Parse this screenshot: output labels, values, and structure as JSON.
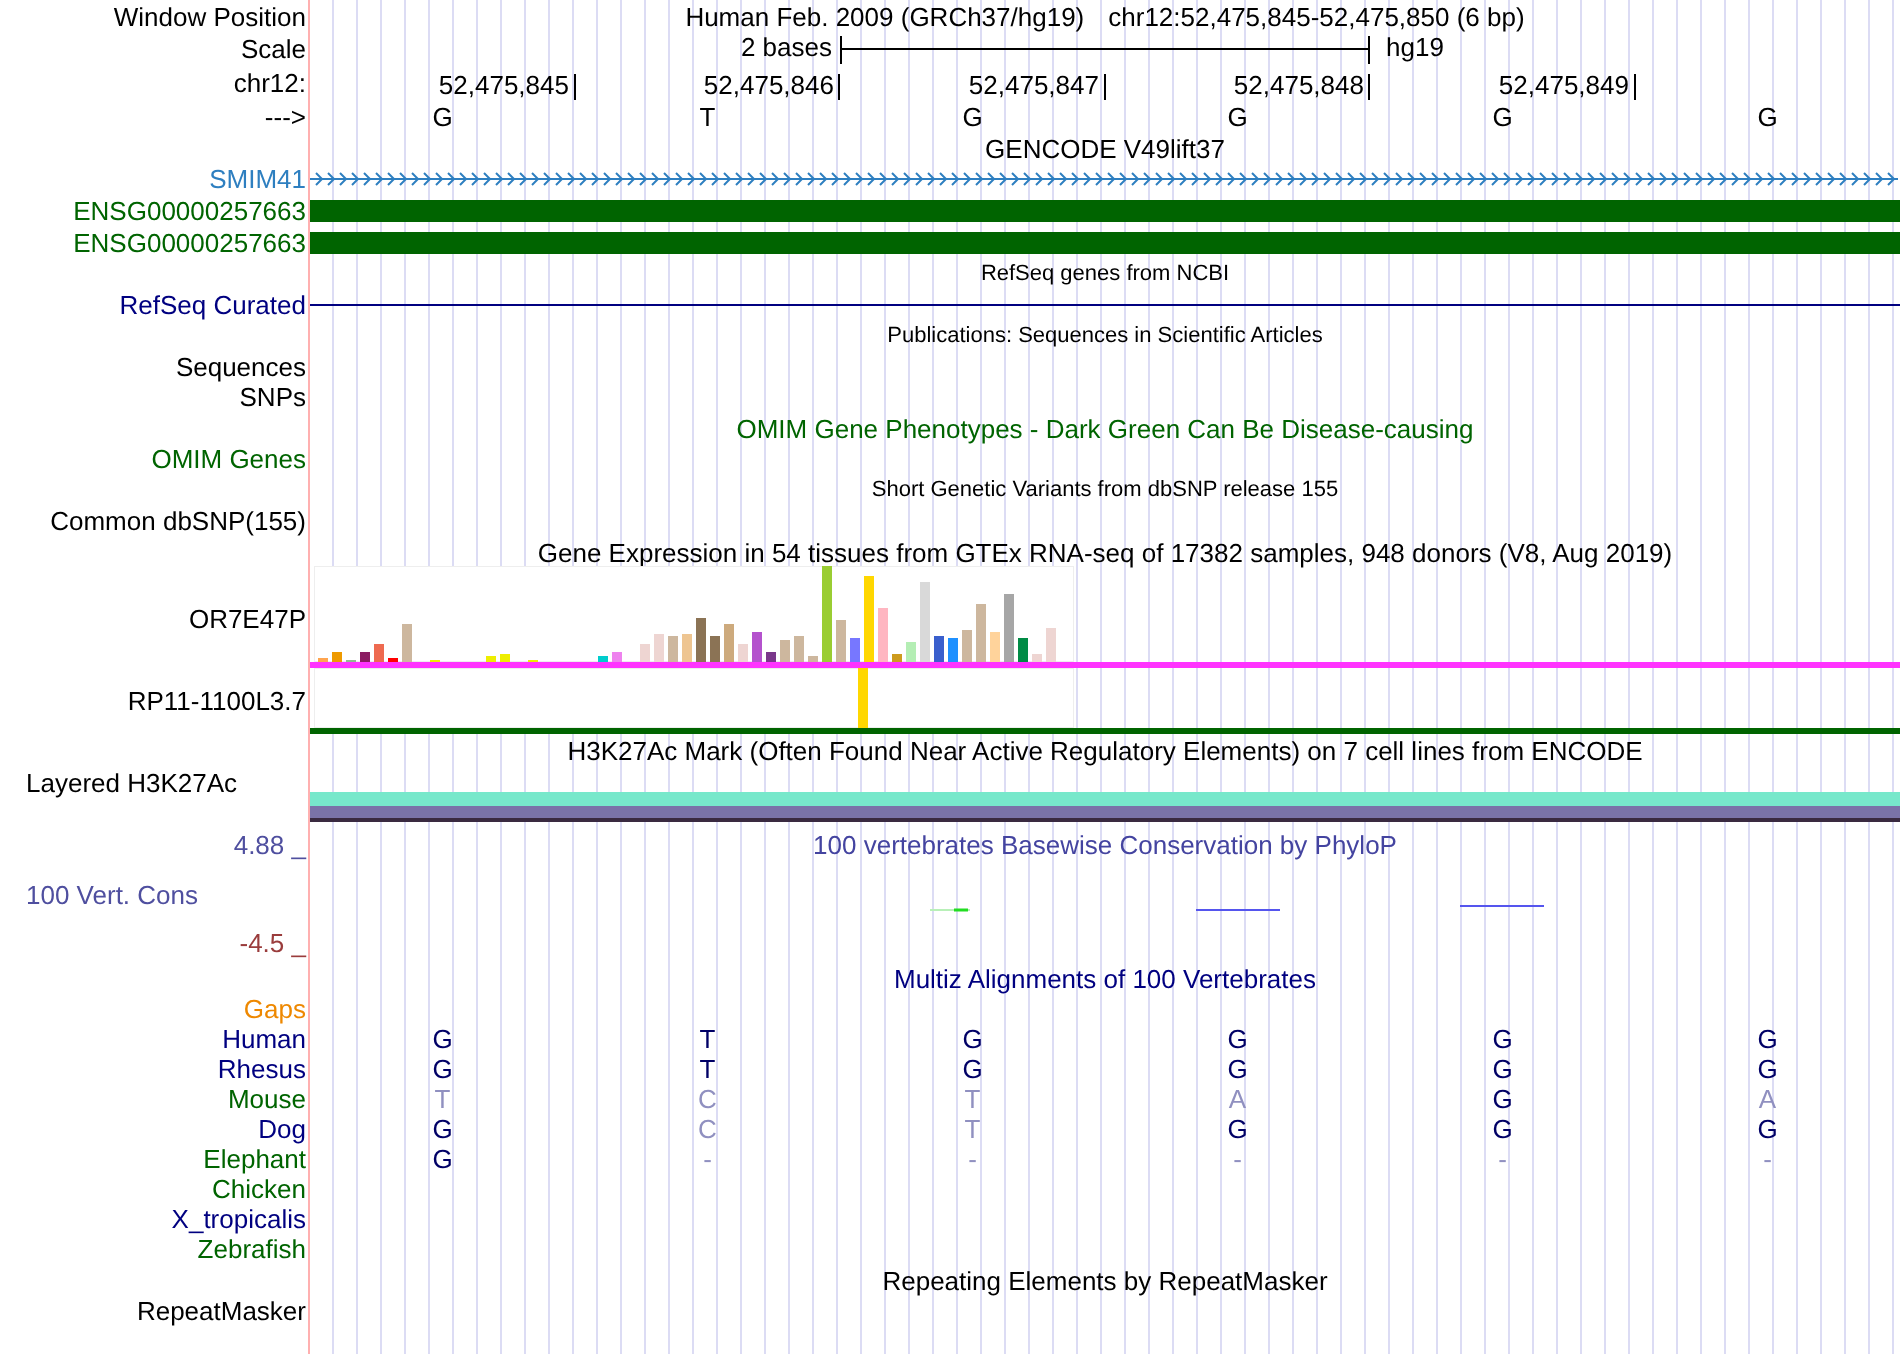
{
  "header": {
    "label": "Window Position",
    "assembly": "Human Feb. 2009 (GRCh37/hg19)",
    "position": "chr12:52,475,845-52,475,850 (6 bp)"
  },
  "scale": {
    "label": "Scale",
    "span": "2 bases",
    "assembly": "hg19"
  },
  "ruler": {
    "label": "chr12:",
    "positions": [
      "52,475,845",
      "52,475,846",
      "52,475,847",
      "52,475,848",
      "52,475,849"
    ]
  },
  "sequence": {
    "label": "--->",
    "bases": [
      "G",
      "T",
      "G",
      "G",
      "G",
      "G"
    ]
  },
  "tracks": [
    {
      "kind": "title",
      "text": "GENCODE V49lift37"
    },
    {
      "kind": "strand",
      "label": "SMIM41",
      "color": "#2e7fc0"
    },
    {
      "kind": "block",
      "label": "ENSG00000257663",
      "color": "#006400"
    },
    {
      "kind": "block",
      "label": "ENSG00000257663",
      "color": "#006400"
    },
    {
      "kind": "caption",
      "text": "RefSeq genes from NCBI"
    },
    {
      "kind": "line",
      "label": "RefSeq Curated",
      "color": "#000080"
    },
    {
      "kind": "caption",
      "text": "Publications: Sequences in Scientific Articles"
    },
    {
      "kind": "label",
      "label": "Sequences"
    },
    {
      "kind": "label",
      "label": "SNPs"
    },
    {
      "kind": "title",
      "text": "OMIM Gene Phenotypes - Dark Green Can Be Disease-causing",
      "color": "#006400"
    },
    {
      "kind": "label",
      "label": "OMIM Genes",
      "color": "#006400"
    },
    {
      "kind": "caption",
      "text": "Short Genetic Variants from dbSNP release 155"
    },
    {
      "kind": "label",
      "label": "Common dbSNP(155)"
    },
    {
      "kind": "title",
      "text": "Gene Expression in 54 tissues from GTEx RNA-seq of 17382 samples, 948 donors (V8, Aug 2019)"
    },
    {
      "kind": "expression",
      "label": "OR7E47P"
    },
    {
      "kind": "peak",
      "label": "RP11-1100L3.7"
    },
    {
      "kind": "title",
      "text": "H3K27Ac Mark (Often Found Near Active Regulatory Elements) on 7 cell lines from ENCODE"
    },
    {
      "kind": "layered",
      "label": "Layered H3K27Ac"
    },
    {
      "kind": "wiggle",
      "max": "4.88 _",
      "label": "100 Vert. Cons",
      "min": "-4.5 _",
      "title": "100 vertebrates Basewise Conservation by PhyloP"
    },
    {
      "kind": "title",
      "text": "Multiz Alignments of 100 Vertebrates",
      "color": "#000080"
    },
    {
      "kind": "label",
      "label": "Gaps",
      "color": "#ee8800"
    },
    {
      "kind": "alignment",
      "label": "Human",
      "color": "#000080",
      "bases": [
        {
          "base": "G",
          "match": true
        },
        {
          "base": "T",
          "match": true
        },
        {
          "base": "G",
          "match": true
        },
        {
          "base": "G",
          "match": true
        },
        {
          "base": "G",
          "match": true
        },
        {
          "base": "G",
          "match": true
        }
      ]
    },
    {
      "kind": "alignment",
      "label": "Rhesus",
      "color": "#000080",
      "bases": [
        {
          "base": "G",
          "match": true
        },
        {
          "base": "T",
          "match": true
        },
        {
          "base": "G",
          "match": true
        },
        {
          "base": "G",
          "match": true
        },
        {
          "base": "G",
          "match": true
        },
        {
          "base": "G",
          "match": true
        }
      ]
    },
    {
      "kind": "alignment",
      "label": "Mouse",
      "color": "#006400",
      "bases": [
        {
          "base": "T",
          "match": false
        },
        {
          "base": "C",
          "match": false
        },
        {
          "base": "T",
          "match": false
        },
        {
          "base": "A",
          "match": false
        },
        {
          "base": "G",
          "match": true
        },
        {
          "base": "A",
          "match": false
        }
      ]
    },
    {
      "kind": "alignment",
      "label": "Dog",
      "color": "#000080",
      "bases": [
        {
          "base": "G",
          "match": true
        },
        {
          "base": "C",
          "match": false
        },
        {
          "base": "T",
          "match": false
        },
        {
          "base": "G",
          "match": true
        },
        {
          "base": "G",
          "match": true
        },
        {
          "base": "G",
          "match": true
        }
      ]
    },
    {
      "kind": "alignment",
      "label": "Elephant",
      "color": "#006400",
      "bases": [
        {
          "base": "G",
          "match": true
        },
        {
          "base": "-",
          "match": false
        },
        {
          "base": "-",
          "match": false
        },
        {
          "base": "-",
          "match": false
        },
        {
          "base": "-",
          "match": false
        },
        {
          "base": "-",
          "match": false
        }
      ]
    },
    {
      "kind": "alignment",
      "label": "Chicken",
      "color": "#006400"
    },
    {
      "kind": "alignment",
      "label": "X_tropicalis",
      "color": "#000080"
    },
    {
      "kind": "alignment",
      "label": "Zebrafish",
      "color": "#006400"
    },
    {
      "kind": "title",
      "text": "Repeating Elements by RepeatMasker"
    },
    {
      "kind": "label",
      "label": "RepeatMasker"
    }
  ]
}
